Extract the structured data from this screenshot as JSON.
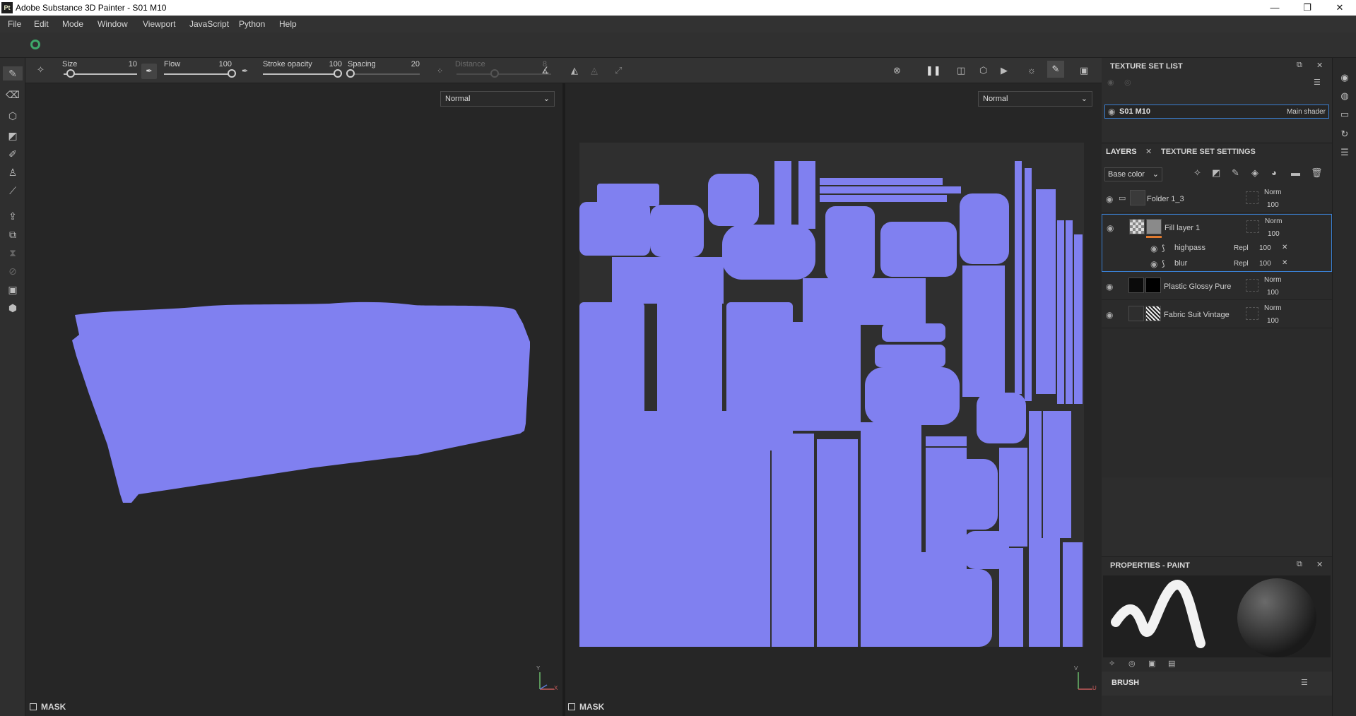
{
  "window": {
    "app_logo": "Pt",
    "title": "Adobe Substance 3D Painter - S01 M10",
    "minimize": "—",
    "maximize": "❐",
    "close": "✕"
  },
  "menu": [
    "File",
    "Edit",
    "Mode",
    "Window",
    "Viewport",
    "JavaScript",
    "Python",
    "Help"
  ],
  "brush": {
    "size_label": "Size",
    "size_value": "10",
    "flow_label": "Flow",
    "flow_value": "100",
    "opacity_label": "Stroke opacity",
    "opacity_value": "100",
    "spacing_label": "Spacing",
    "spacing_value": "20",
    "distance_label": "Distance",
    "distance_value": "8"
  },
  "slider_levels": {
    "size": 0.1,
    "flow": 1.0,
    "stroke_opacity": 1.0,
    "spacing": 0.02,
    "distance": 0.4
  },
  "viewport3d": {
    "blend_mode": "Normal",
    "mask_label": "MASK",
    "axis_y": "Y",
    "axis_x": "X"
  },
  "viewport2d": {
    "blend_mode": "Normal",
    "mask_label": "MASK",
    "axis_v": "V",
    "axis_u": "U"
  },
  "texture_set_list": {
    "title": "TEXTURE SET LIST",
    "item_name": "S01 M10",
    "item_shader": "Main shader"
  },
  "layers_panel": {
    "tab_layers": "LAYERS",
    "tab_settings": "TEXTURE SET SETTINGS",
    "channel": "Base color",
    "layers": [
      {
        "name": "Folder 1_3",
        "blend": "Norm",
        "opacity": "100"
      },
      {
        "name": "Fill layer 1",
        "blend": "Norm",
        "opacity": "100"
      },
      {
        "name": "Plastic Glossy Pure",
        "blend": "Norm",
        "opacity": "100"
      },
      {
        "name": "Fabric Suit Vintage",
        "blend": "Norm",
        "opacity": "100"
      }
    ],
    "effects": [
      {
        "name": "highpass",
        "blend": "Repl",
        "opacity": "100"
      },
      {
        "name": "blur",
        "blend": "Repl",
        "opacity": "100"
      }
    ]
  },
  "properties": {
    "title": "PROPERTIES - PAINT",
    "brush_section": "BRUSH"
  },
  "colors": {
    "uv_fill": "#8080f0",
    "accent": "#3a7fd1",
    "background": "#262626"
  }
}
